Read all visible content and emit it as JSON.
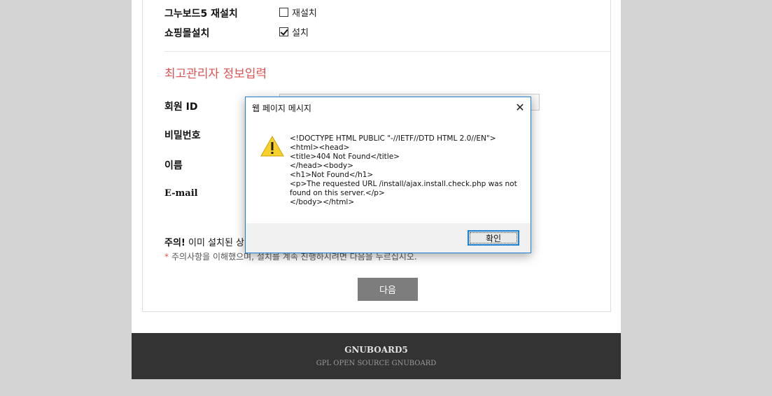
{
  "options": {
    "reinstall": {
      "label": "그누보드5 재설치",
      "checkbox_label": "재설치",
      "checked": false
    },
    "shop": {
      "label": "쇼핑몰설치",
      "checkbox_label": "설치",
      "checked": true
    }
  },
  "admin": {
    "section_title": "최고관리자 정보입력",
    "fields": {
      "id": "회원 ID",
      "password": "비밀번호",
      "name": "이름",
      "email": "E-mail"
    }
  },
  "notice": {
    "prefix": "주의!",
    "text": " 이미 설치된 상태라",
    "star": "*",
    "agreement": "주의사항을 이해했으며, 설치를 계속 진행하시려면 다음을 누르십시오."
  },
  "next_button": "다음",
  "footer": {
    "title": "GNUBOARD5",
    "subtitle": "GPL OPEN SOURCE GNUBOARD"
  },
  "dialog": {
    "title": "웹 페이지 메시지",
    "close": "✕",
    "icon": "warning-icon",
    "message": "<!DOCTYPE HTML PUBLIC \"-//IETF//DTD HTML 2.0//EN\">\n<html><head>\n<title>404 Not Found</title>\n</head><body>\n<h1>Not Found</h1>\n<p>The requested URL /install/ajax.install.check.php was not found on this server.</p>\n</body></html>",
    "ok_label": "확인"
  },
  "colors": {
    "accent_red": "#e05252",
    "dialog_border": "#1b7fd6",
    "footer_bg": "#333333",
    "button_gray": "#7d7d7d"
  }
}
